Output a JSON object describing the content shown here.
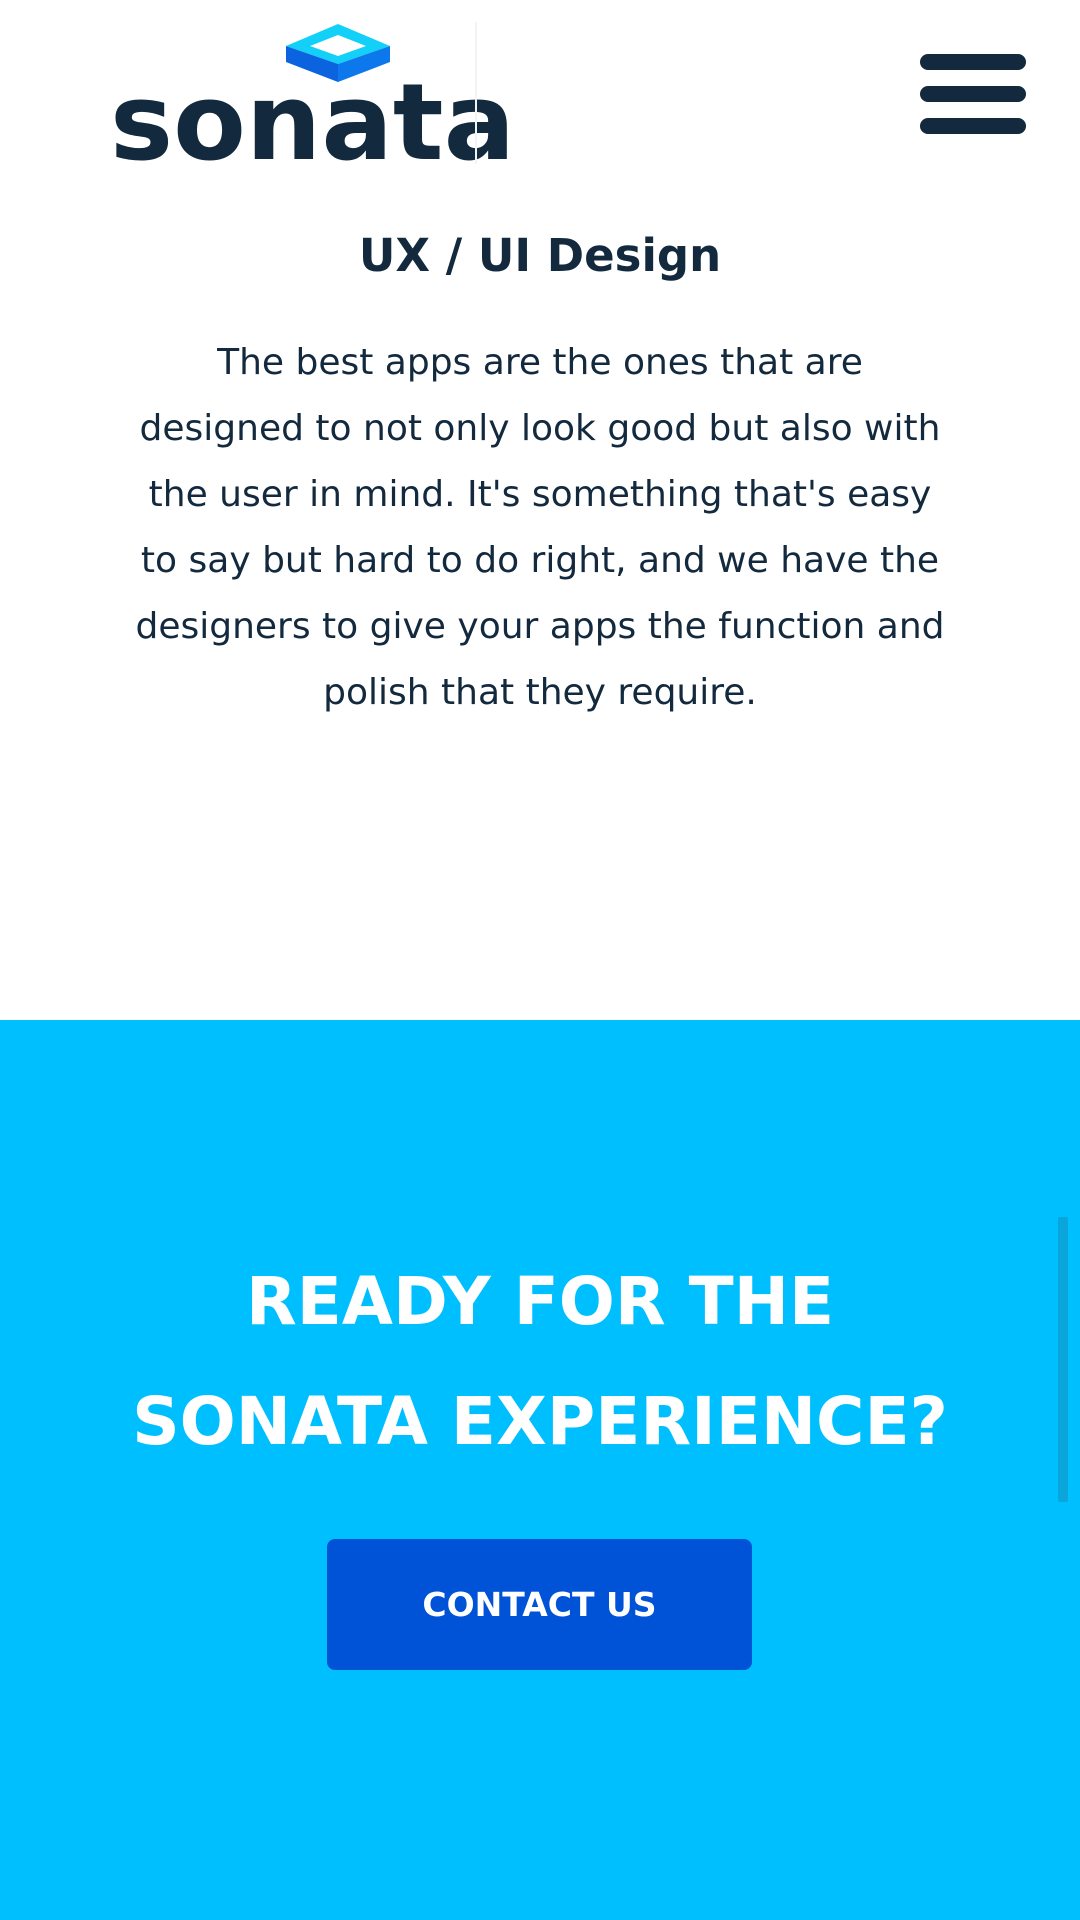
{
  "header": {
    "logo_text": "sonata",
    "menu_icon": "hamburger-menu-icon",
    "logo_icon": "diamond-logo-icon"
  },
  "service": {
    "title": "UX / UI Design",
    "description": "The best apps are the ones that are designed to not only look good but also with the user in mind. It's something that's easy to say but hard to do right, and we have the designers to give your apps the function and polish that they require."
  },
  "cta": {
    "heading_line1": "READY FOR THE",
    "heading_line2": "SONATA EXPERIENCE?",
    "button_label": "CONTACT US"
  },
  "colors": {
    "brand_dark": "#13293d",
    "cta_background": "#00bfff",
    "button_background": "#0052d6",
    "logo_light": "#00d4f5",
    "logo_dark": "#0b63e0"
  }
}
